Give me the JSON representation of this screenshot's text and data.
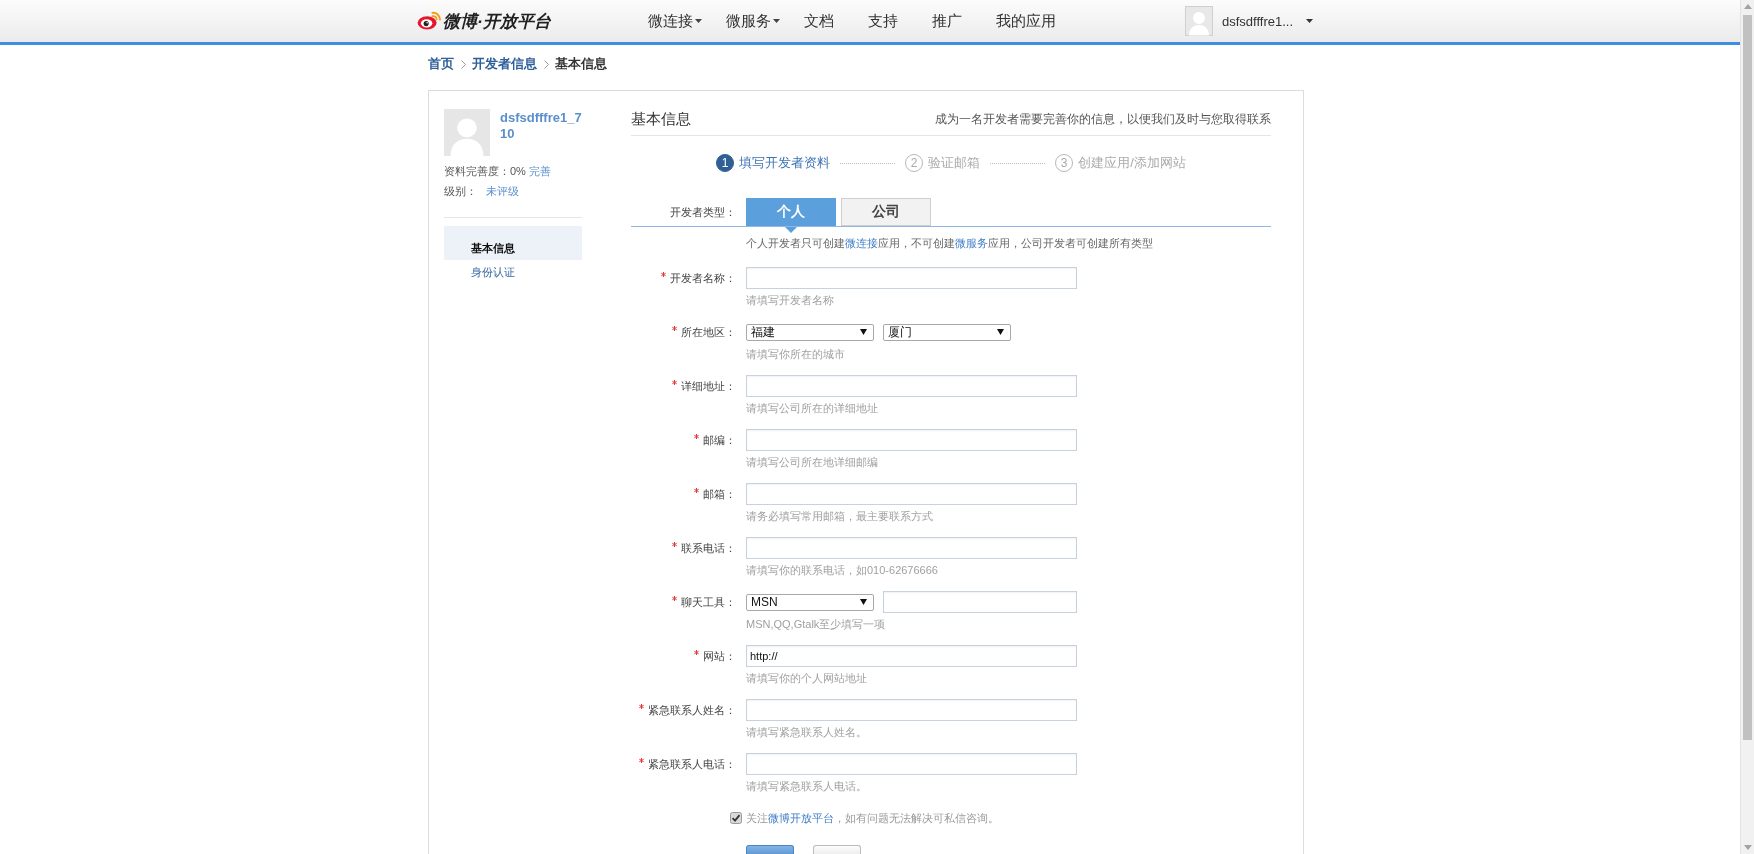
{
  "header": {
    "logo_text": "微博·开放平台",
    "nav": [
      {
        "label": "微连接",
        "dropdown": true
      },
      {
        "label": "微服务",
        "dropdown": true
      },
      {
        "label": "文档",
        "dropdown": false
      },
      {
        "label": "支持",
        "dropdown": false
      },
      {
        "label": "推广",
        "dropdown": false
      },
      {
        "label": "我的应用",
        "dropdown": false
      }
    ],
    "user_name": "dsfsdfffre1..."
  },
  "breadcrumb": [
    {
      "label": "首页",
      "link": true
    },
    {
      "label": "开发者信息",
      "link": true
    },
    {
      "label": "基本信息",
      "link": false
    }
  ],
  "sidebar": {
    "user_name": "dsfsdfffre1_710",
    "completeness_label": "资料完善度：0%",
    "completeness_link": "完善",
    "level_label": "级别：",
    "level_value": "未评级",
    "menu": [
      {
        "label": "基本信息",
        "selected": true
      },
      {
        "label": "身份认证",
        "selected": false
      }
    ]
  },
  "main": {
    "title": "基本信息",
    "subtitle": "成为一名开发者需要完善你的信息，以便我们及时与您取得联系",
    "steps": [
      {
        "number": "1",
        "label": "填写开发者资料",
        "active": true
      },
      {
        "number": "2",
        "label": "验证邮箱",
        "active": false
      },
      {
        "number": "3",
        "label": "创建应用/添加网站",
        "active": false
      }
    ],
    "developer_type": {
      "label": "开发者类型：",
      "tabs": [
        {
          "label": "个人",
          "selected": true
        },
        {
          "label": "公司",
          "selected": false
        }
      ],
      "note": [
        {
          "kind": "text",
          "text": "个人开发者只可创建"
        },
        {
          "kind": "link",
          "text": "微连接"
        },
        {
          "kind": "text",
          "text": "应用，不可创建"
        },
        {
          "kind": "link",
          "text": "微服务"
        },
        {
          "kind": "text",
          "text": "应用，公司开发者可创建所有类型"
        }
      ]
    },
    "fields": [
      {
        "kind": "text",
        "label": "开发者名称：",
        "required": true,
        "hint": "请填写开发者名称"
      },
      {
        "kind": "region",
        "label": "所在地区：",
        "required": true,
        "selects": [
          "福建",
          "厦门"
        ],
        "hint": "请填写你所在的城市"
      },
      {
        "kind": "text",
        "label": "详细地址：",
        "required": true,
        "hint": "请填写公司所在的详细地址"
      },
      {
        "kind": "text",
        "label": "邮编：",
        "required": true,
        "hint": "请填写公司所在地详细邮编"
      },
      {
        "kind": "text",
        "label": "邮箱：",
        "required": true,
        "hint": "请务必填写常用邮箱，最主要联系方式"
      },
      {
        "kind": "text",
        "label": "联系电话：",
        "required": true,
        "hint": "请填写你的联系电话，如010-62676666"
      },
      {
        "kind": "chat",
        "label": "聊天工具：",
        "required": true,
        "select": "MSN",
        "hint": "MSN,QQ,Gtalk至少填写一项"
      },
      {
        "kind": "text",
        "label": "网站：",
        "required": true,
        "value": "http://",
        "hint": "请填写你的个人网站地址"
      },
      {
        "kind": "text",
        "label": "紧急联系人姓名：",
        "required": true,
        "hint": "请填写紧急联系人姓名。"
      },
      {
        "kind": "text",
        "label": "紧急联系人电话：",
        "required": true,
        "hint": "请填写紧急联系人电话。"
      }
    ],
    "follow": {
      "checked": true,
      "text": [
        {
          "kind": "text",
          "text": "关注"
        },
        {
          "kind": "link",
          "text": "微博开放平台"
        },
        {
          "kind": "text",
          "text": "，如有问题无法解决可私信咨询。"
        }
      ]
    },
    "buttons": [
      {
        "kind": "primary"
      },
      {
        "kind": "secondary"
      }
    ]
  }
}
